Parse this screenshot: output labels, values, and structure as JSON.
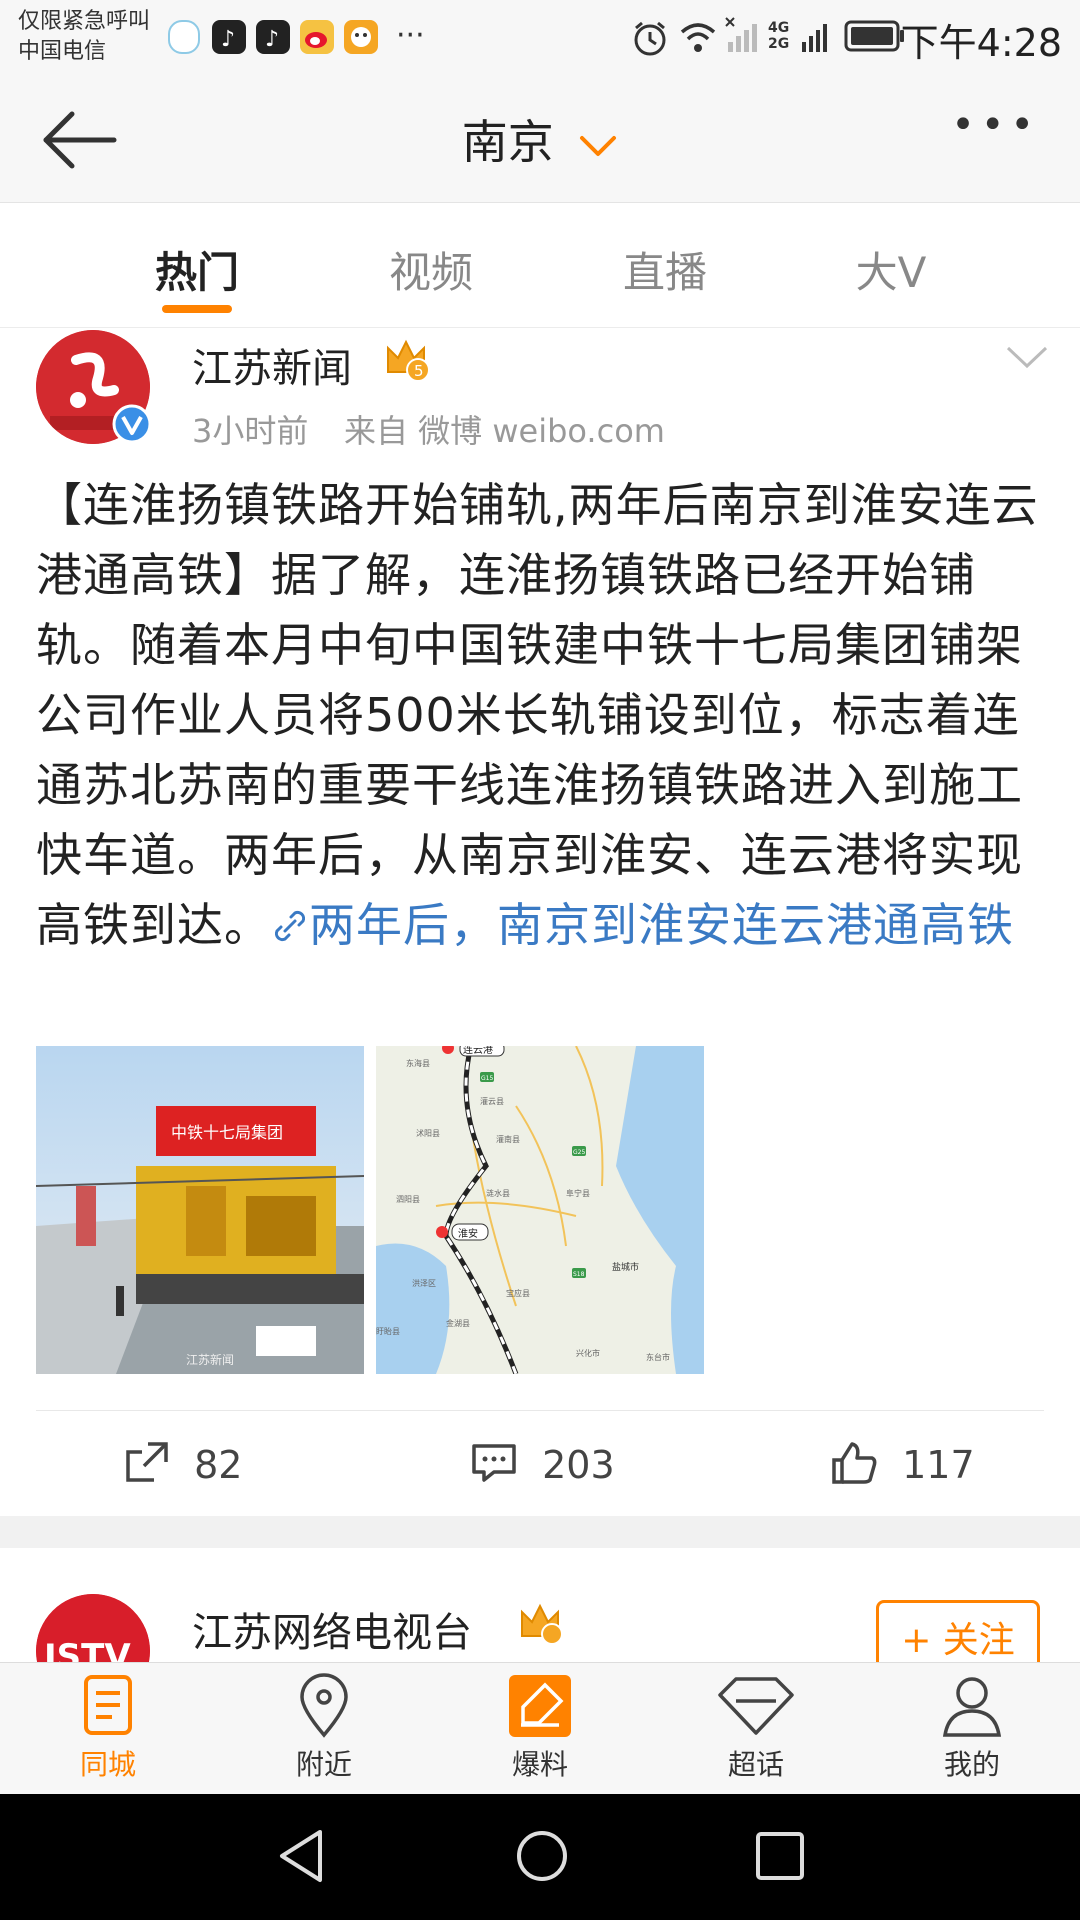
{
  "status_bar": {
    "carrier_line1": "仅限紧急呼叫",
    "carrier_line2": "中国电信",
    "more": "···",
    "network": "4G 2G",
    "time": "下午4:28"
  },
  "nav": {
    "city": "南京",
    "more": "•••"
  },
  "tabs": [
    {
      "label": "热门"
    },
    {
      "label": "视频"
    },
    {
      "label": "直播"
    },
    {
      "label": "大V"
    }
  ],
  "post1": {
    "username": "江苏新闻",
    "level": "5",
    "time": "3小时前",
    "source": "来自 微博 weibo.com",
    "text_main": "【连淮扬镇铁路开始铺轨,两年后南京到淮安连云港通高铁】据了解，连淮扬镇铁路已经开始铺轨。随着本月中旬中国铁建中铁十七局集团铺架公司作业人员将500米长轨铺设到位，标志着连通苏北苏南的重要干线连淮扬镇铁路进入到施工快车道。两年后，从南京到淮安、连云港将实现高铁到达。",
    "link_text": "两年后，南京到淮安连云港通高铁",
    "image1_banner": "中铁十七局集团",
    "image1_watermark": "江苏新闻",
    "map_labels": {
      "a": "连云港",
      "b": "淮安",
      "c": "盐城市",
      "d": "东海县",
      "e": "灌云县",
      "f": "沭阳县",
      "g": "灌南县",
      "h": "涟水县",
      "i": "阜宁县",
      "j": "泗阳县",
      "k": "洪泽区",
      "l": "金湖县",
      "m": "宝应县",
      "n": "盱眙县",
      "o": "兴化市",
      "p": "东台市",
      "q": "G15",
      "r": "G25",
      "s": "S18"
    },
    "reposts": "82",
    "comments": "203",
    "likes": "117"
  },
  "post2": {
    "username": "江苏网络电视台",
    "avatar_text": "JSTV",
    "follow_label": "+ 关注"
  },
  "bottom_tabs": [
    {
      "label": "同城"
    },
    {
      "label": "附近"
    },
    {
      "label": "爆料"
    },
    {
      "label": "超话"
    },
    {
      "label": "我的"
    }
  ],
  "colors": {
    "accent": "#ff8200",
    "link": "#3a7ac4"
  }
}
